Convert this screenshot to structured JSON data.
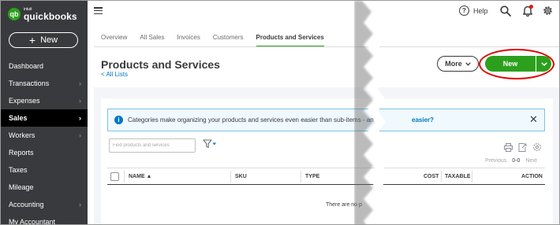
{
  "brand": {
    "small": "intuit",
    "name": "quickbooks",
    "mark": "qb"
  },
  "sidebar": {
    "new_button": "New",
    "items": [
      {
        "label": "Dashboard",
        "has_chevron": false
      },
      {
        "label": "Transactions",
        "has_chevron": true
      },
      {
        "label": "Expenses",
        "has_chevron": true
      },
      {
        "label": "Sales",
        "has_chevron": true,
        "active": true
      },
      {
        "label": "Workers",
        "has_chevron": true
      },
      {
        "label": "Reports",
        "has_chevron": false
      },
      {
        "label": "Taxes",
        "has_chevron": false
      },
      {
        "label": "Mileage",
        "has_chevron": false
      },
      {
        "label": "Accounting",
        "has_chevron": true
      },
      {
        "label": "My Accountant",
        "has_chevron": false
      }
    ]
  },
  "topbar": {
    "help_label": "Help",
    "help_glyph": "?"
  },
  "tabs": [
    {
      "label": "Overview"
    },
    {
      "label": "All Sales"
    },
    {
      "label": "Invoices"
    },
    {
      "label": "Customers"
    },
    {
      "label": "Products and Services",
      "active": true
    }
  ],
  "header": {
    "title": "Products and Services",
    "back_link": "All Lists",
    "back_glyph": "<",
    "more_button": "More",
    "new_button": "New"
  },
  "banner": {
    "info_glyph": "i",
    "text": "Categories make organizing your products and services even easier than sub-items - an",
    "link_tail": "easier?",
    "close_glyph": "✕"
  },
  "search": {
    "placeholder": "Find products and services",
    "value": ""
  },
  "pager": {
    "previous": "Previous",
    "range": "0-0",
    "next": "Next"
  },
  "table": {
    "columns": [
      "NAME ▲",
      "SKU",
      "TYPE",
      "COST",
      "TAXABLE",
      "ACTION"
    ],
    "empty_message": "There are no p"
  },
  "colors": {
    "accent": "#2ca01c",
    "link": "#0077c5",
    "sidebar": "#393a3d",
    "highlight": "#e00000"
  },
  "icons": [
    "hamburger-icon",
    "help-icon",
    "search-icon",
    "bell-icon",
    "gear-icon",
    "filter-icon",
    "print-icon",
    "export-icon",
    "settings-icon",
    "info-icon",
    "close-icon"
  ]
}
